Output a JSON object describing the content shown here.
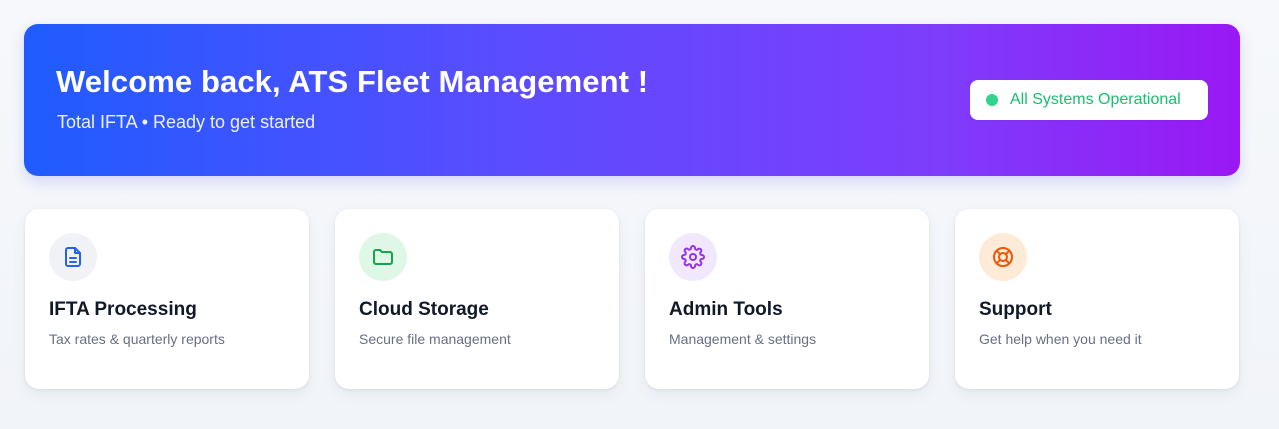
{
  "hero": {
    "title": "Welcome back, ATS Fleet Management !",
    "subtitle": "Total IFTA • Ready to get started",
    "status": "All Systems Operational"
  },
  "cards": [
    {
      "title": "IFTA Processing",
      "description": "Tax rates & quarterly reports",
      "icon": "document-icon",
      "icon_color": "#2563eb",
      "icon_bg": "#f0f2f6"
    },
    {
      "title": "Cloud Storage",
      "description": "Secure file management",
      "icon": "folder-icon",
      "icon_color": "#16a34a",
      "icon_bg": "#dff7e6"
    },
    {
      "title": "Admin Tools",
      "description": "Management & settings",
      "icon": "gear-icon",
      "icon_color": "#9333ea",
      "icon_bg": "#f2e8fd"
    },
    {
      "title": "Support",
      "description": "Get help when you need it",
      "icon": "lifebuoy-icon",
      "icon_color": "#ea580c",
      "icon_bg": "#fdebd7"
    }
  ],
  "colors": {
    "hero_gradient_start": "#1f5cff",
    "hero_gradient_end": "#9a18f5",
    "status_dot": "#32d38a",
    "status_text": "#16c06e"
  }
}
